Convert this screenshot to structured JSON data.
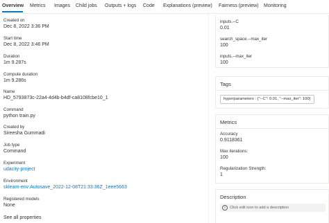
{
  "tabs": [
    "Overview",
    "Metrics",
    "Images",
    "Child jobs",
    "Outputs + logs",
    "Code",
    "Explanations (preview)",
    "Fairness (preview)",
    "Monitoring"
  ],
  "properties": {
    "created_on_label": "Created on",
    "created_on_value": "Dec 8, 2022 3:36 PM",
    "start_time_label": "Start time",
    "start_time_value": "Dec 8, 2022 3:46 PM",
    "duration_label": "Duration",
    "duration_value": "1m 9.287s",
    "compute_duration_label": "Compute duration",
    "compute_duration_value": "1m 9.286s",
    "name_label": "Name",
    "name_value": "HD_5793873c-22a4-4d4b-b4df-ca8108fcbe10_1",
    "command_label": "Command",
    "command_value": "python train.py",
    "created_by_label": "Created by",
    "created_by_value": "Sireesha Gummadi",
    "job_type_label": "Job type",
    "job_type_value": "Command",
    "experiment_label": "Experiment",
    "experiment_value": "udacity-project",
    "environment_label": "Environment",
    "environment_value": "sklearn-env:Autosave_2022-12-08T21:33:36Z_1eee5663",
    "registered_models_label": "Registered models",
    "registered_models_value": "None",
    "see_all_label": "See all properties"
  },
  "inputs_card": {
    "c_label": "inputs.--C",
    "c_value": "0.01",
    "search_label": "search_space.--max_iter",
    "search_value": "100",
    "max_iter_label": "inputs.--max_iter",
    "max_iter_value": "100"
  },
  "tags_card": {
    "title": "Tags",
    "chip": "hyperparameters : {\"--C\": 0.01, \"--max_iter\": 100}"
  },
  "metrics_card": {
    "title": "Metrics",
    "accuracy_label": "Accuracy",
    "accuracy_value": "0.9118361",
    "max_iter_label": "Max iterations:",
    "max_iter_value": "100",
    "reg_label": "Regularization Strength:",
    "reg_value": "1"
  },
  "description_card": {
    "title": "Description",
    "hint": "Click edit icon to add a description"
  }
}
